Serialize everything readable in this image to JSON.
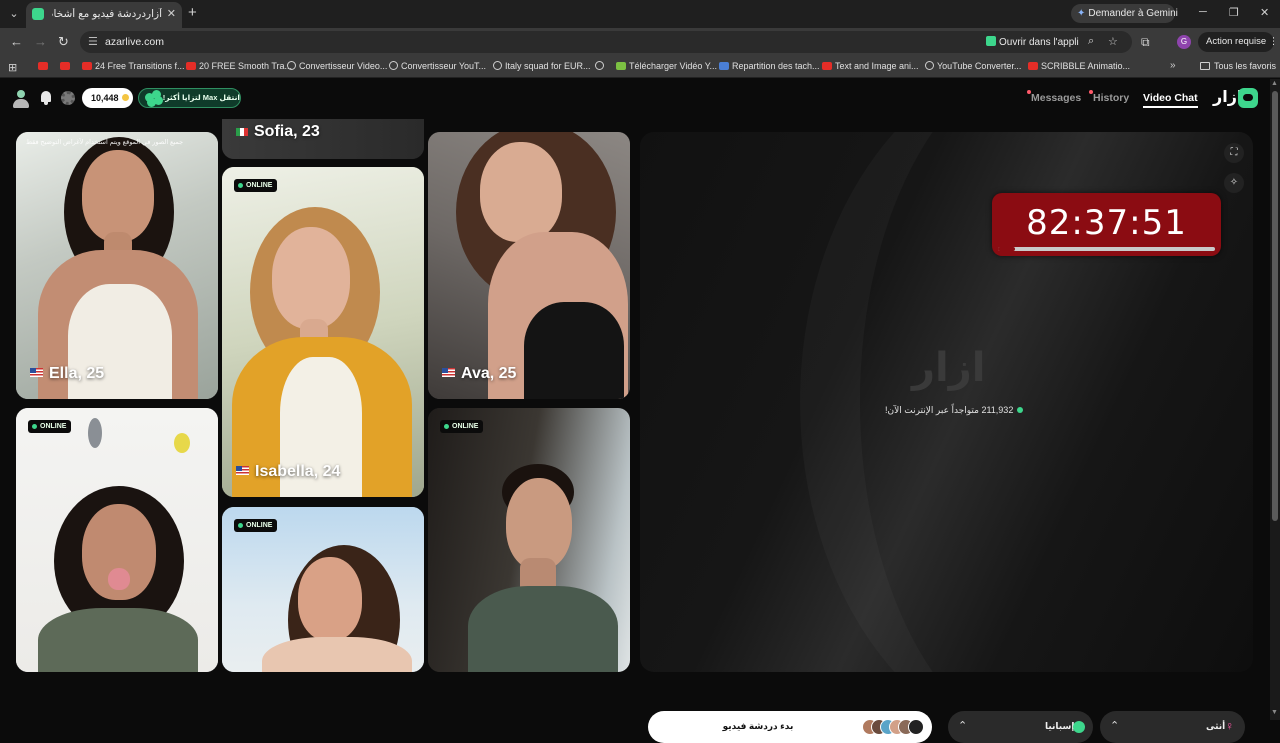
{
  "browser": {
    "tab_title": "آزار‏دردشة فيديو مع أشخاص جدد",
    "gemini": "Demander à Gemini",
    "url": "azarlive.com",
    "open_app": "Ouvrir dans l'appli",
    "profile_initial": "G",
    "action_required": "Action requise",
    "bookmarks": [
      {
        "label": "",
        "icon": "youtube"
      },
      {
        "label": "",
        "icon": "youtube"
      },
      {
        "label": "24 Free Transitions f...",
        "icon": "youtube"
      },
      {
        "label": "20 FREE Smooth Tra...",
        "icon": "youtube"
      },
      {
        "label": "Convertisseur Video...",
        "icon": "google"
      },
      {
        "label": "Convertisseur YouT...",
        "icon": "globe"
      },
      {
        "label": "Italy squad for EUR...",
        "icon": "globe"
      },
      {
        "label": "",
        "icon": "globe"
      },
      {
        "label": "Télécharger Vidéo Y...",
        "icon": "download"
      },
      {
        "label": "Repartition des tach...",
        "icon": "docs"
      },
      {
        "label": "Text and Image ani...",
        "icon": "youtube"
      },
      {
        "label": "YouTube Converter...",
        "icon": "globe"
      },
      {
        "label": "SCRIBBLE Animatio...",
        "icon": "youtube"
      }
    ],
    "all_bookmarks": "Tous les favoris"
  },
  "header": {
    "coins": "10,448",
    "max_promo": "انتقل Max لتزايا أكثر!",
    "nav": {
      "messages": "Messages",
      "history": "History",
      "video_chat": "Video Chat"
    },
    "brand": "ازار"
  },
  "cards": [
    {
      "name": "Ella, 25",
      "online": "",
      "caption": "جميع الصور في الموقع ويتم استخدام لأغراض التوضيح فقط"
    },
    {
      "name": "Sofia, 23",
      "online": ""
    },
    {
      "name": "Isabella, 24",
      "online": "ONLINE"
    },
    {
      "name": "",
      "online": "ONLINE"
    },
    {
      "name": "Ava, 25",
      "online": ""
    },
    {
      "name": "",
      "online": "ONLINE"
    },
    {
      "name": "",
      "online": "ONLINE"
    }
  ],
  "video": {
    "timer": "82:37:51",
    "timer_progress": 0.08,
    "watermark": "ازار",
    "online_count": "211,932",
    "online_text": "متواجداً عبر الإنترنت الآن!"
  },
  "controls": {
    "start": "بدء دردشة فيديو",
    "region": "إسبانيا",
    "gender": "أنثى"
  },
  "colors": {
    "accent": "#3dd68c",
    "timer_bg": "#8b0c12",
    "online_dot": "#3dd68c"
  }
}
